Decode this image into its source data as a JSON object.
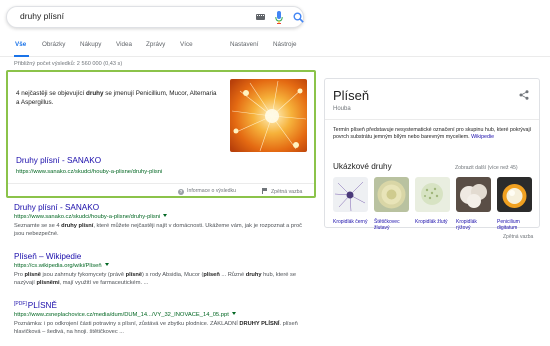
{
  "search": {
    "query": "druhy plísní"
  },
  "tabs": {
    "all": "Vše",
    "images": "Obrázky",
    "shopping": "Nákupy",
    "videos": "Videa",
    "news": "Zprávy",
    "more": "Více",
    "settings": "Nastavení",
    "tools": "Nástroje"
  },
  "stats": "Přibližný počet výsledků: 2 560 000 (0,43 s)",
  "featured": {
    "text_pre": "4 nejčastěji se objevující ",
    "text_bold": "druhy",
    "text_post": " se jmenují Penicillium, Mucor, Alternaria a Aspergillus.",
    "title": "Druhy plísní - SANAKO",
    "url": "https://www.sanako.cz/skudci/houby-a-plisne/druhy-plisni",
    "about_label": "Informace o výsledku",
    "feedback_label": "Zpětná vazba"
  },
  "results": [
    {
      "title": "Druhy plísní - SANAKO",
      "url": "https://www.sanako.cz/skudci/houby-a-plisne/druhy-plisni",
      "snippet_html": "Seznamte se se 4 <b>druhy plísní</b>, které můžete nejčastěji najít v domácnosti. Ukážeme vám, jak je rozpoznat a proč jsou nebezpečné."
    },
    {
      "title": "Plíseň – Wikipedie",
      "url": "https://cs.wikipedia.org/wiki/Plíseň",
      "snippet_html": "Pro <b>plísně</b> jsou zahrnuty fykomycety (právě <b>plísně</b>) s rody Absidia, Mucor (<b>plíseň</b> ... Různé <b>druhy</b> hub, které se nazývají <b>plísněmi</b>, mají využití ve farmaceutickém. ..."
    },
    {
      "pdf_tag": "[PDF]",
      "title": "PLÍSNĚ",
      "url": "https://www.zsneplachovice.cz/media/dum/DUM_14.../VY_32_INOVACE_14_05.ppt",
      "snippet_html": "Poznámka: i po odkrojení části potraviny s plísní, zůstává ve zbytku plodnice. ZÁKLADNÍ <b>DRUHY PLÍSNÍ</b>. plíseň hlavičková – šedivá, na hnoji. štětičkovec ..."
    }
  ],
  "knowledge_panel": {
    "title": "Plíseň",
    "subtitle": "Houba",
    "description": "Termín plíseň představuje nesystematické označení pro skupinu hub, které pokrývají povrch substrátu jemným bílým nebo barevným myceliem.",
    "source": "Wikipedie",
    "section_title": "Ukázkové druhy",
    "more_label": "Zobrazit další (více než 45)",
    "species": [
      {
        "name": "Kropidlák černý"
      },
      {
        "name": "Štětičkovec žlutavý"
      },
      {
        "name": "Kropidlák žlutý"
      },
      {
        "name": "Kropidlák rýžový"
      },
      {
        "name": "Penicilium digitatum"
      }
    ],
    "feedback_label": "Zpětná vazba"
  },
  "colors": {
    "accent_blue": "#1a73e8",
    "link": "#1a0dab",
    "url_green": "#006621",
    "snippet_border": "#8bc34a"
  }
}
